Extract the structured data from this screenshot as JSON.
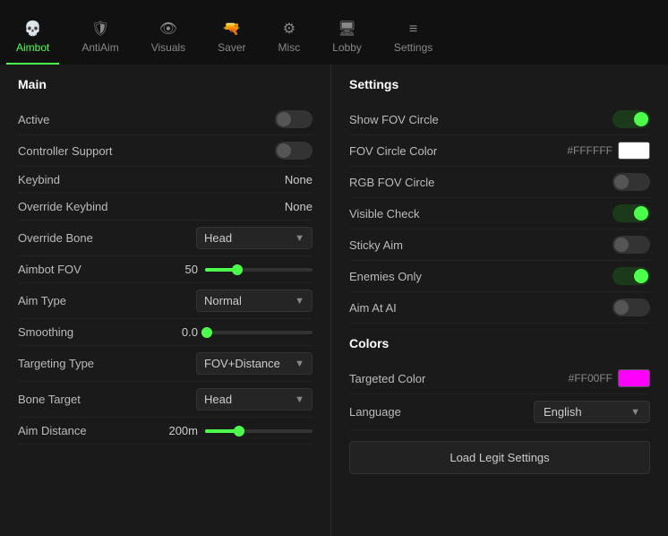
{
  "nav": {
    "items": [
      {
        "id": "aimbot",
        "label": "Aimbot",
        "icon": "💀",
        "active": true
      },
      {
        "id": "antiaim",
        "label": "AntiAim",
        "icon": "🛡",
        "active": false
      },
      {
        "id": "visuals",
        "label": "Visuals",
        "icon": "👁",
        "active": false
      },
      {
        "id": "saver",
        "label": "Saver",
        "icon": "🔫",
        "active": false
      },
      {
        "id": "misc",
        "label": "Misc",
        "icon": "⚙",
        "active": false
      },
      {
        "id": "lobby",
        "label": "Lobby",
        "icon": "🖥",
        "active": false
      },
      {
        "id": "settings",
        "label": "Settings",
        "icon": "≡",
        "active": false
      }
    ]
  },
  "left": {
    "title": "Main",
    "rows": [
      {
        "label": "Active",
        "type": "toggle",
        "value": false
      },
      {
        "label": "Controller Support",
        "type": "toggle",
        "value": false
      },
      {
        "label": "Keybind",
        "type": "value",
        "value": "None"
      },
      {
        "label": "Override Keybind",
        "type": "value",
        "value": "None"
      },
      {
        "label": "Override Bone",
        "type": "dropdown",
        "value": "Head"
      },
      {
        "label": "Aimbot FOV",
        "type": "slider",
        "numval": "50",
        "pct": 30
      },
      {
        "label": "Aim Type",
        "type": "dropdown",
        "value": "Normal"
      },
      {
        "label": "Smoothing",
        "type": "slider",
        "numval": "0.0",
        "pct": 2
      },
      {
        "label": "Targeting Type",
        "type": "dropdown",
        "value": "FOV+Distance"
      },
      {
        "label": "Bone Target",
        "type": "dropdown",
        "value": "Head"
      },
      {
        "label": "Aim Distance",
        "type": "slider",
        "numval": "200m",
        "pct": 32
      }
    ]
  },
  "right": {
    "title": "Settings",
    "rows": [
      {
        "label": "Show FOV Circle",
        "type": "dot-toggle",
        "value": true
      },
      {
        "label": "FOV Circle Color",
        "type": "color",
        "hex": "#FFFFFF",
        "color": "#FFFFFF"
      },
      {
        "label": "RGB FOV Circle",
        "type": "toggle-off",
        "value": false
      },
      {
        "label": "Visible Check",
        "type": "dot-toggle",
        "value": true
      },
      {
        "label": "Sticky Aim",
        "type": "toggle-off",
        "value": false
      },
      {
        "label": "Enemies Only",
        "type": "dot-toggle",
        "value": true
      },
      {
        "label": "Aim At AI",
        "type": "toggle-off",
        "value": false
      }
    ],
    "colors_title": "Colors",
    "colors_rows": [
      {
        "label": "Targeted Color",
        "type": "color",
        "hex": "#FF00FF",
        "color": "#FF00FF"
      },
      {
        "label": "Language",
        "type": "lang-dropdown",
        "value": "English"
      }
    ],
    "load_button": "Load Legit Settings"
  }
}
